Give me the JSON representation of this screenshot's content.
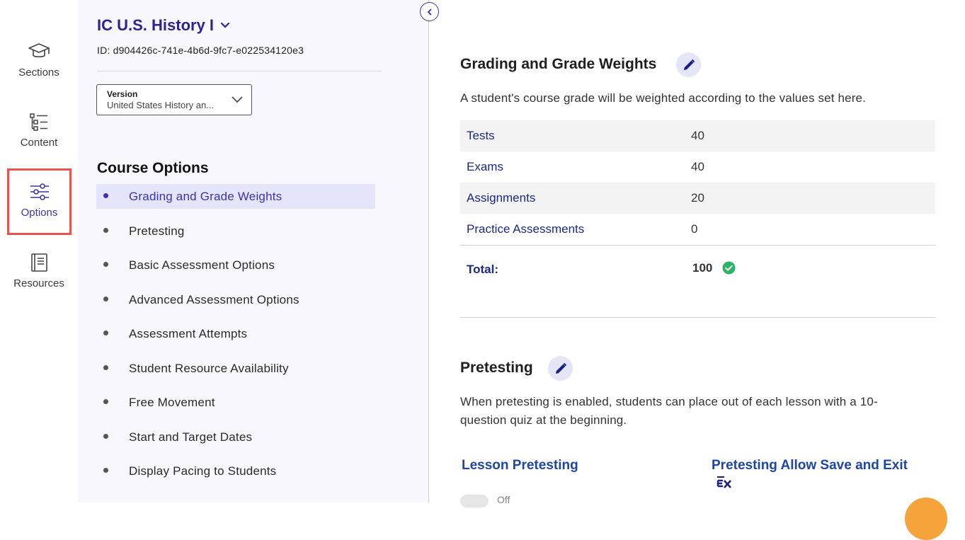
{
  "rail": {
    "items": [
      {
        "label": "Sections",
        "icon": "graduation-cap-icon"
      },
      {
        "label": "Content",
        "icon": "tree-list-icon"
      },
      {
        "label": "Options",
        "icon": "sliders-icon",
        "active": true
      },
      {
        "label": "Resources",
        "icon": "book-icon"
      }
    ]
  },
  "course": {
    "title": "IC U.S. History I",
    "id_text": "ID: d904426c-741e-4b6d-9fc7-e022534120e3"
  },
  "version": {
    "label": "Version",
    "value": "United States History an..."
  },
  "course_options": {
    "heading": "Course Options",
    "items": [
      "Grading and Grade Weights",
      "Pretesting",
      "Basic Assessment Options",
      "Advanced Assessment Options",
      "Assessment Attempts",
      "Student Resource Availability",
      "Free Movement",
      "Start and Target Dates",
      "Display Pacing to Students"
    ],
    "selected_index": 0
  },
  "grading": {
    "title": "Grading and Grade Weights",
    "description": "A student's course grade will be weighted according to the values set here.",
    "rows": [
      {
        "name": "Tests",
        "value": "40"
      },
      {
        "name": "Exams",
        "value": "40"
      },
      {
        "name": "Assignments",
        "value": "20"
      },
      {
        "name": "Practice Assessments",
        "value": "0"
      }
    ],
    "total_label": "Total:",
    "total_value": "100"
  },
  "pretesting": {
    "title": "Pretesting",
    "description_line1": "When pretesting is enabled, students can place out of each lesson with a 10-",
    "description_line2": "question quiz at the beginning.",
    "lesson_pretesting": "Lesson Pretesting",
    "allow_save_exit": "Pretesting Allow Save and Exit",
    "toggle_state": "Off"
  },
  "colors": {
    "accent": "#3b33a8",
    "link": "#1b2a80",
    "highlight": "#e8544e",
    "success": "#2bb463"
  }
}
